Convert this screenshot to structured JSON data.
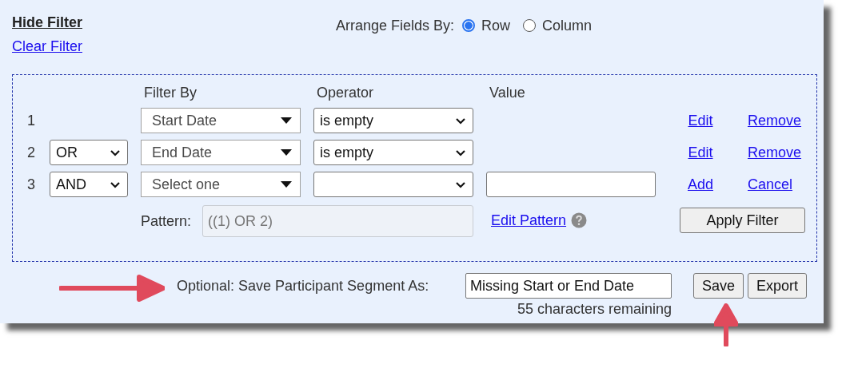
{
  "header": {
    "hide_filter": "Hide Filter",
    "clear_filter": "Clear Filter",
    "arrange": {
      "label": "Arrange Fields By:",
      "options": [
        {
          "label": "Row",
          "selected": true
        },
        {
          "label": "Column",
          "selected": false
        }
      ]
    }
  },
  "filter": {
    "columns": [
      "Filter By",
      "Operator",
      "Value"
    ],
    "rows": [
      {
        "number": "1",
        "filter_by": "Start Date",
        "operator": "is empty",
        "has_value_field": false,
        "actions": [
          "Edit",
          "Remove"
        ]
      },
      {
        "number": "2",
        "logic": "OR",
        "filter_by": "End Date",
        "operator": "is empty",
        "has_value_field": false,
        "actions": [
          "Edit",
          "Remove"
        ]
      },
      {
        "number": "3",
        "logic": "AND",
        "filter_by": "Select one",
        "has_value_field": true,
        "actions": [
          "Add",
          "Cancel"
        ]
      }
    ],
    "pattern": {
      "label": "Pattern:",
      "value": "((1) OR 2)",
      "disabled": true
    },
    "edit_pattern": "Edit Pattern",
    "apply": "Apply Filter"
  },
  "save": {
    "label": "Optional: Save Participant Segment As:",
    "value": "Missing Start or End Date",
    "remaining": "55 characters remaining",
    "buttons": [
      "Save",
      "Export"
    ]
  }
}
